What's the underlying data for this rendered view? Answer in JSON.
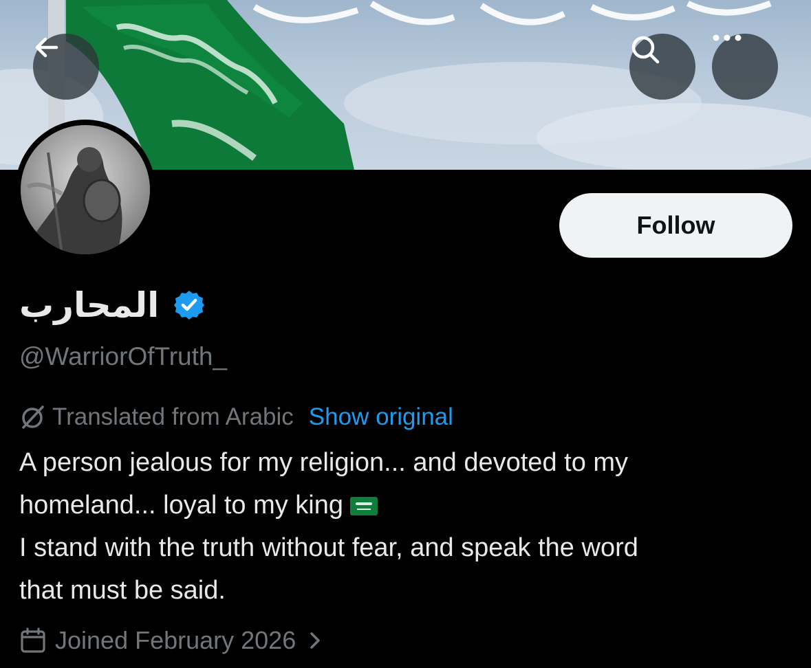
{
  "header": {
    "back_icon": "arrow-left-icon",
    "search_icon": "search-icon",
    "more_icon": "more-horizontal-icon"
  },
  "profile": {
    "display_name": "المحارب",
    "verified": true,
    "handle": "@WarriorOfTruth_",
    "follow_label": "Follow"
  },
  "translation": {
    "label": "Translated from Arabic",
    "action": "Show original"
  },
  "bio": {
    "line1": "A person jealous for my religion... and devoted to my",
    "line2": "homeland... loyal to my king",
    "line3": "I stand with the truth without fear, and speak the word",
    "line4": "that must be said."
  },
  "joined": {
    "label": "Joined February 2026"
  },
  "colors": {
    "background": "#000000",
    "text_primary": "#e7e9ea",
    "text_secondary": "#71767b",
    "link": "#1d9bf0",
    "verified": "#1d9bf0",
    "follow_bg": "#eff3f4",
    "flag_green": "#0f7d3c"
  }
}
